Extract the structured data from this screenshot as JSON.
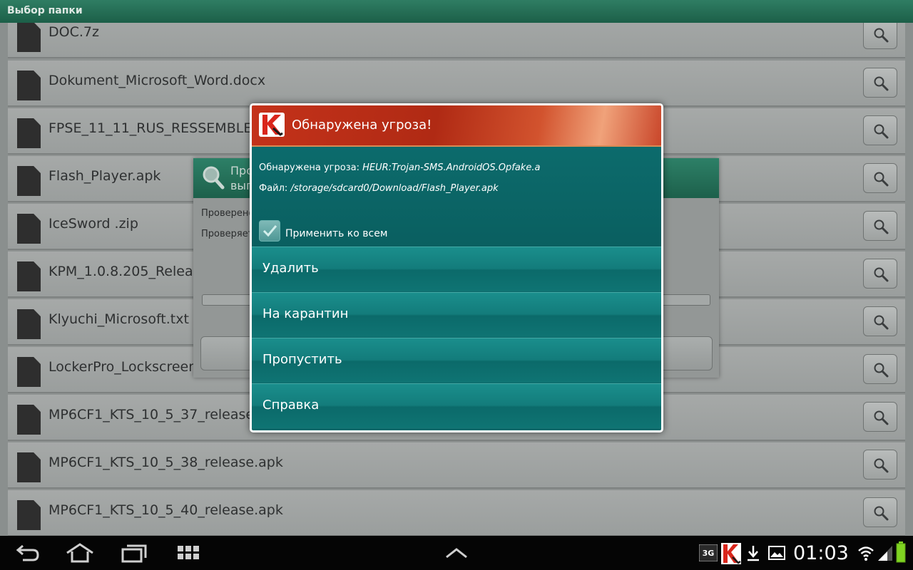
{
  "window": {
    "title": "Выбор папки"
  },
  "files": [
    {
      "name": "DOC.7z"
    },
    {
      "name": "Dokument_Microsoft_Word.docx"
    },
    {
      "name": "FPSE_11_11_RUS_RESSEMBLER"
    },
    {
      "name": "Flash_Player.apk"
    },
    {
      "name": "IceSword .zip"
    },
    {
      "name": "KPM_1.0.8.205_Releas"
    },
    {
      "name": "Klyuchi_Microsoft.txt"
    },
    {
      "name": "LockerPro_Lockscreen_"
    },
    {
      "name": "MP6CF1_KTS_10_5_37_release."
    },
    {
      "name": "MP6CF1_KTS_10_5_38_release.apk"
    },
    {
      "name": "MP6CF1_KTS_10_5_40_release.apk"
    }
  ],
  "scan_dialog": {
    "title": "Про\nвып",
    "line1": "Проверено",
    "line2": "Проверяет"
  },
  "threat_dialog": {
    "title": "Обнаружена угроза!",
    "threat_label": "Обнаружена угроза:",
    "threat_name": "HEUR:Trojan-SMS.AndroidOS.Opfake.a",
    "file_label": "Файл:",
    "file_path": "/storage/sdcard0/Download/Flash_Player.apk",
    "apply_all": {
      "label": "Применить ко всем",
      "checked": true
    },
    "actions": [
      {
        "label": "Удалить"
      },
      {
        "label": "На карантин"
      },
      {
        "label": "Пропустить"
      },
      {
        "label": "Справка"
      }
    ]
  },
  "status_bar": {
    "time": "01:03",
    "network": "3G",
    "battery_color": "#7fd321"
  },
  "colors": {
    "accent_teal": "#0e6a6b",
    "header_red": "#c4321a",
    "topbar_green": "#2f7d63"
  }
}
